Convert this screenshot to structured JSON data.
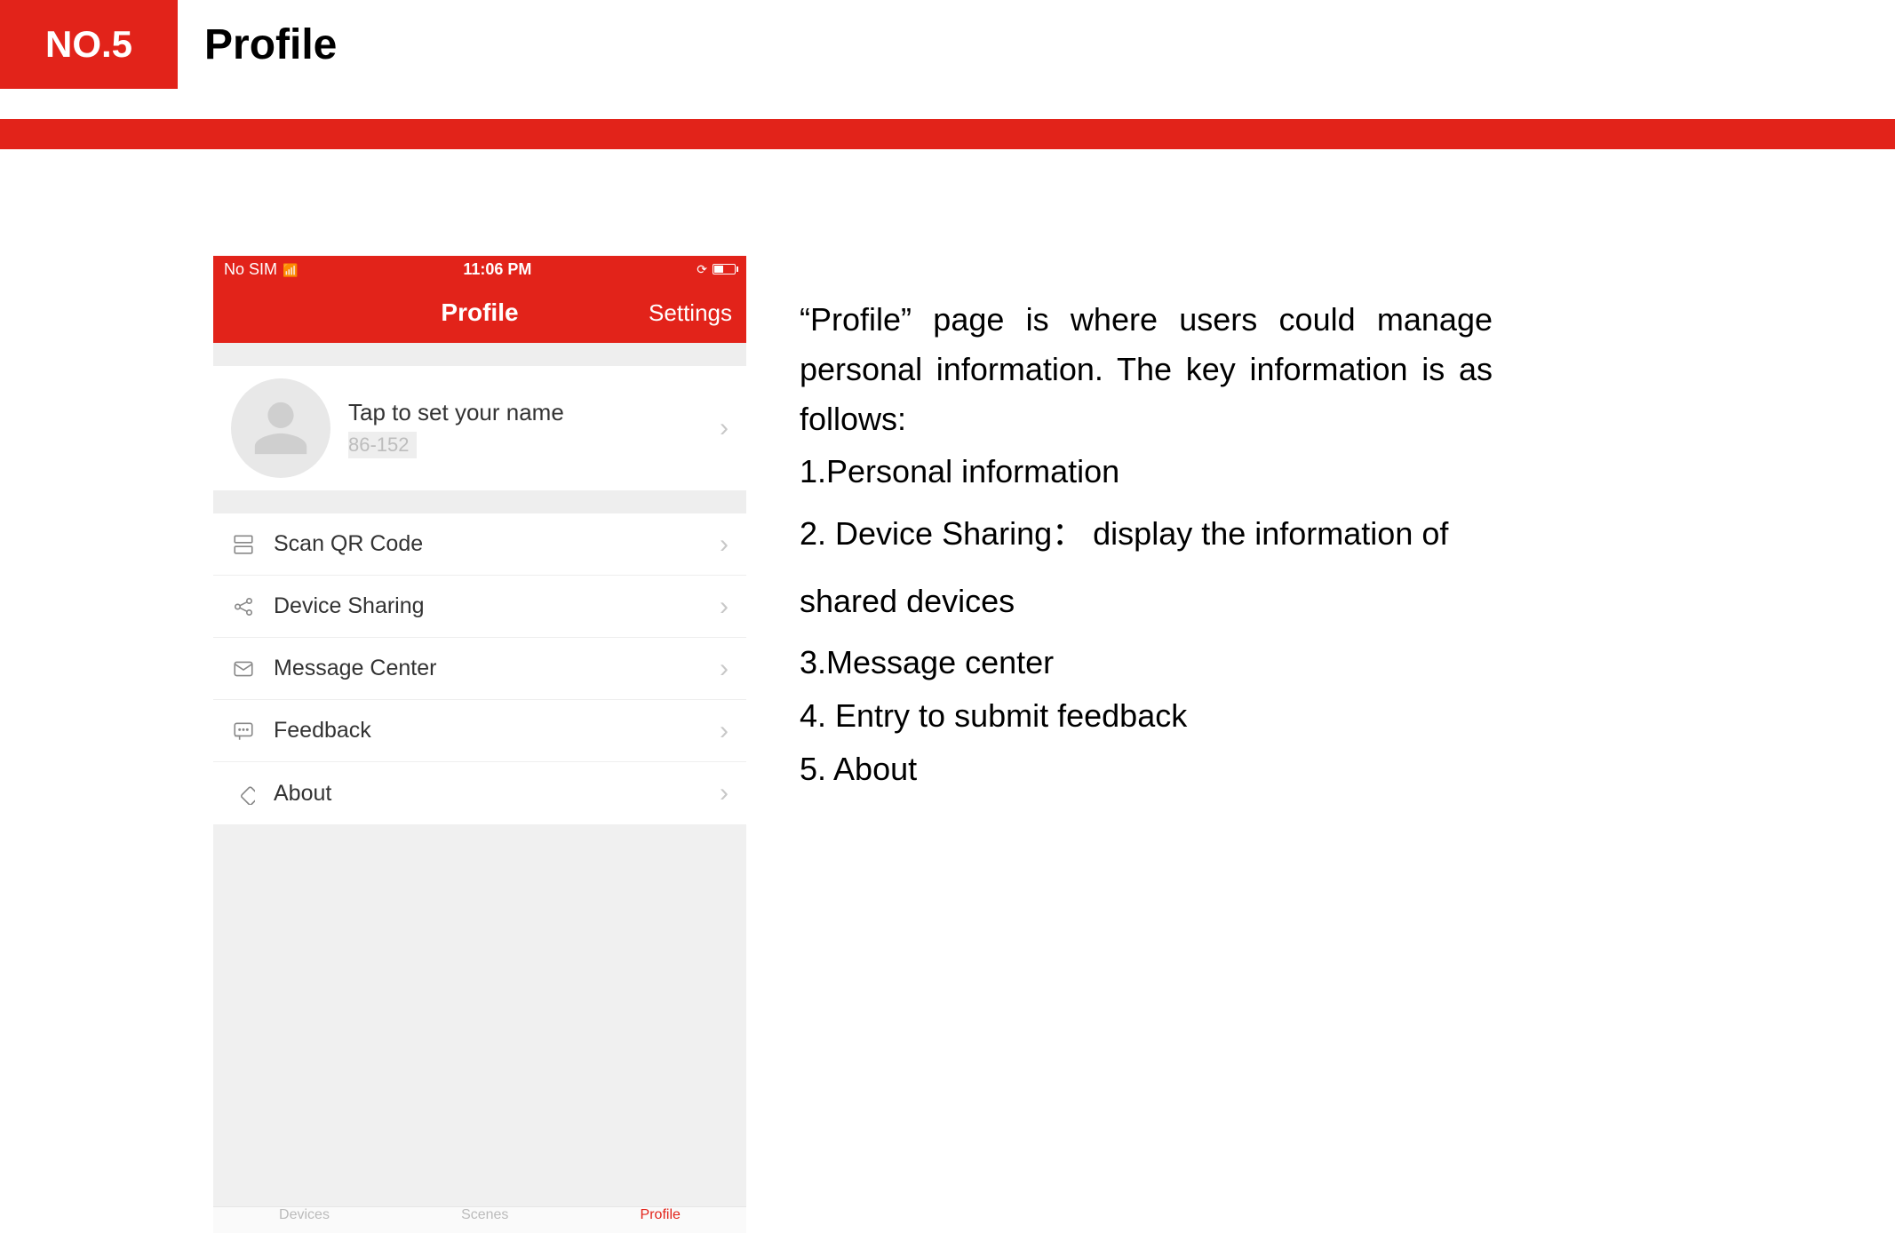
{
  "header": {
    "badge": "NO.5",
    "title": "Profile"
  },
  "phone": {
    "status": {
      "carrier": "No SIM",
      "time": "11:06 PM"
    },
    "nav": {
      "title": "Profile",
      "right": "Settings"
    },
    "profile": {
      "name_prompt": "Tap to set your name",
      "phone": "86-152"
    },
    "menu": [
      {
        "key": "scan",
        "label": "Scan QR Code"
      },
      {
        "key": "share",
        "label": "Device Sharing"
      },
      {
        "key": "msg",
        "label": "Message Center"
      },
      {
        "key": "fb",
        "label": "Feedback"
      },
      {
        "key": "about",
        "label": "About"
      }
    ],
    "tabs": {
      "devices": "Devices",
      "scenes": "Scenes",
      "profile": "Profile"
    }
  },
  "description": {
    "intro": "“Profile” page is where users could manage personal information. The key information is as follows:",
    "items": [
      "1.Personal information",
      "2. Device Sharing： display the information of shared devices",
      "3.Message center",
      "4. Entry to submit feedback",
      "5. About"
    ]
  }
}
